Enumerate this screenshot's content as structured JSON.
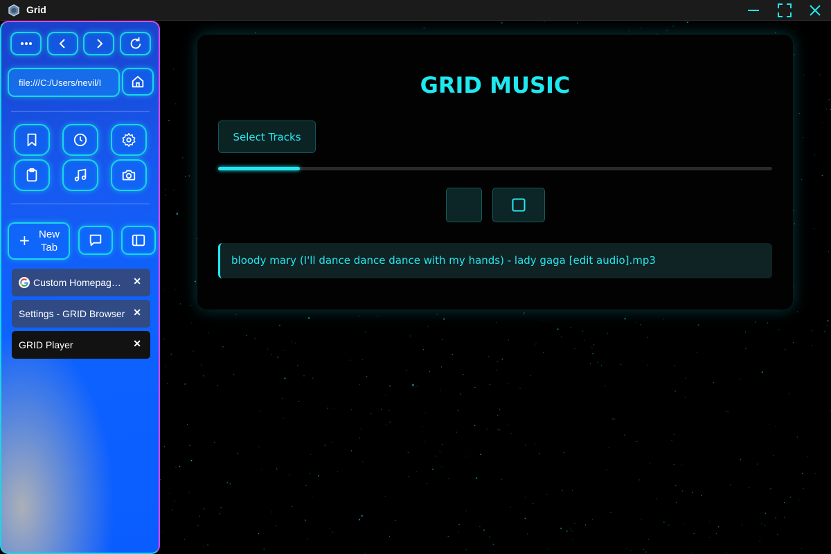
{
  "window": {
    "title": "Grid",
    "accent": "#1ad7e5",
    "controls": [
      "minimize-icon",
      "maximize-icon",
      "close-icon"
    ]
  },
  "sidebar": {
    "nav_buttons": [
      "more-icon",
      "back-icon",
      "forward-icon",
      "reload-icon"
    ],
    "url": "file:///C:/Users/nevil/Desktop/GRID",
    "url_visible": "file:///C:/Users/nevil/I",
    "home_icon": "home-icon",
    "tools": [
      "bookmark-icon",
      "history-icon",
      "settings-icon",
      "clipboard-icon",
      "music-icon",
      "camera-icon"
    ],
    "new_tab_label": "New Tab",
    "new_tab_line1": "New",
    "new_tab_line2": "Tab",
    "extra_buttons": [
      "chat-icon",
      "sidebar-toggle-icon"
    ],
    "tabs": [
      {
        "label": "Custom Homepage",
        "visible_label": "Custom Homepag…",
        "icon": "google-icon",
        "close": "✕"
      },
      {
        "label": "Settings - GRID Browser",
        "visible_label": "Settings - GRID Browser",
        "close": "✕"
      },
      {
        "label": "GRID Player",
        "visible_label": "GRID Player",
        "close": "✕",
        "active": true
      }
    ]
  },
  "player": {
    "title": "GRID MUSIC",
    "select_label": "Select Tracks",
    "progress": 0.147,
    "controls": [
      "play-pause-button",
      "stop-icon"
    ],
    "tracks": [
      "bloody mary (I'll dance dance dance with my hands) - lady gaga [edit audio].mp3"
    ],
    "accent": "#1ee8f0"
  }
}
